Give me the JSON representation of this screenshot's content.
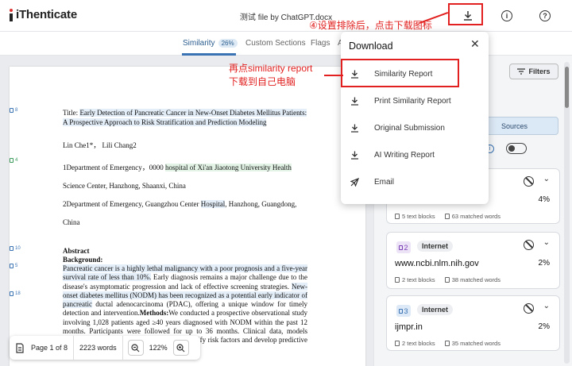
{
  "header": {
    "brand": "iThenticate",
    "doc_title": "测试 file by ChatGPT.docx"
  },
  "annotations": {
    "step4": "④设置排除后，点击下载图标",
    "line1": "再点similarity report",
    "line2": "下载到自己电脑"
  },
  "tabs": {
    "similarity": "Similarity",
    "similarity_badge": "26%",
    "custom": "Custom Sections",
    "flags": "Flags",
    "ai": "A"
  },
  "popup": {
    "title": "Download",
    "items": [
      "Similarity Report",
      "Print Similarity Report",
      "Original Submission",
      "AI Writing Report",
      "Email"
    ]
  },
  "document": {
    "markers": [
      "8",
      "4",
      "10",
      "5",
      "18"
    ],
    "title_label": "Title: ",
    "title_text": "Early Detection of Pancreatic Cancer in New-Onset Diabetes Mellitus Patients: A Prospective Approach to Risk Stratification and Prediction Modeling",
    "authors": "Lin Che1*， Lili Chang2",
    "affil1_pre": "1Department of Emergency，0000 ",
    "affil1_hl": "hospital of  Xi'an Jiaotong University Health",
    "affil1_line2": "Science Center, Hanzhong, Shaanxi, China",
    "affil2_pre": "2Department of Emergency, Guangzhou Center ",
    "affil2_hl": "Hospital",
    "affil2_post": ", Hanzhong, Guangdong,",
    "affil2_line2": "China",
    "abstract_h": "Abstract",
    "background_h": "Background:",
    "para_a": "Pancreatic cancer is a highly lethal malignancy with a poor prognosis and a five-year survival rate of less than 10%.",
    "para_b": " Early diagnosis remains a major challenge due to the disease's asymptomatic progression and lack of effective screening strategies. ",
    "para_c": "New-onset diabetes mellitus (NODM) has been recognized as a potential early indicator of pancreatic",
    "para_d": " ductal adenocarcinoma (PDAC), offering a unique window for timely detection and intervention.",
    "methods_h": "Methods:",
    "para_e": "We conducted a prospective observational study involving 1,028 patients aged ≥40 years diagnosed with NODM within the past 12 months. Participants were followed for up to 36 months. Clinical data, ",
    "para_f": "models (LASSO, random forest, ...) were used to identify risk factors and develop predictive models for"
  },
  "zoombar": {
    "page": "Page 1 of 8",
    "words": "2223 words",
    "zoom": "122%"
  },
  "panel": {
    "filters": "Filters",
    "sources": "Sources",
    "cards": [
      {
        "num": "",
        "type": "",
        "domain": "",
        "pct": "4%",
        "blocks": "5 text blocks",
        "matched": "63 matched words"
      },
      {
        "num": "2",
        "type": "Internet",
        "domain": "www.ncbi.nlm.nih.gov",
        "pct": "2%",
        "blocks": "2 text blocks",
        "matched": "38 matched words"
      },
      {
        "num": "3",
        "type": "Internet",
        "domain": "ijmpr.in",
        "pct": "2%",
        "blocks": "2 text blocks",
        "matched": "35 matched words"
      }
    ]
  },
  "colors": {
    "accent": "#3a73b4",
    "annotation_red": "#e1201f",
    "brand_dot": "#dd3333"
  }
}
